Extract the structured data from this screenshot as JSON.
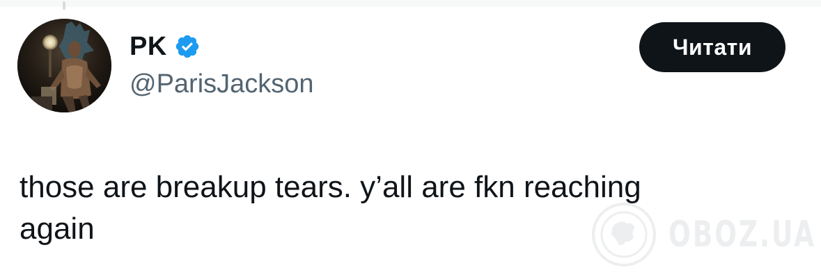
{
  "tweet": {
    "author": {
      "display_name": "PK",
      "handle": "@ParisJackson",
      "verified": true,
      "verified_icon": "verified-badge-icon",
      "avatar_icon": "profile-avatar"
    },
    "follow_button_label": "Читати",
    "text_line_1": "those are breakup tears. y’all are fkn reaching",
    "text_line_2": "again"
  },
  "watermark": {
    "text": "OBOZ.UA",
    "icon": "globe-logo-icon"
  },
  "colors": {
    "text_primary": "#0f1419",
    "text_secondary": "#536471",
    "verified_blue": "#1d9bf0",
    "button_bg": "#0f1419",
    "button_text": "#ffffff"
  }
}
